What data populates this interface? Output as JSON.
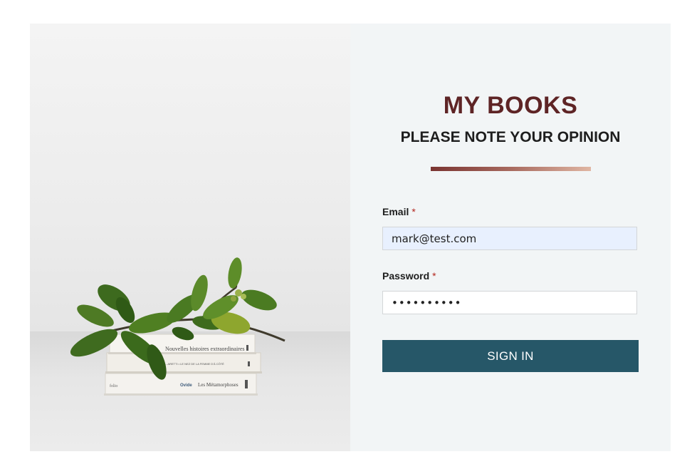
{
  "hero": {
    "image": "stacked-books-with-leaves-photo",
    "book_spines": [
      "Nouvelles histoires extraordinaires",
      "...ARETTI • LE NEZ DE LA FEMME D'À CÔTÉ",
      "Les Métamorphoses"
    ],
    "book_publishers": [
      "folio",
      "Ovide"
    ]
  },
  "form": {
    "title": "MY BOOKS",
    "subtitle": "PLEASE NOTE YOUR OPINION",
    "email": {
      "label": "Email",
      "required_mark": "*",
      "value": "mark@test.com"
    },
    "password": {
      "label": "Password",
      "required_mark": "*",
      "value": "••••••••••"
    },
    "submit_label": "SIGN IN"
  },
  "colors": {
    "title": "#5e2425",
    "button": "#265768",
    "panel_bg": "#f2f5f6",
    "email_autofill_bg": "#e8f0fe",
    "divider_start": "#7a3431",
    "divider_end": "#e0b6a3"
  }
}
